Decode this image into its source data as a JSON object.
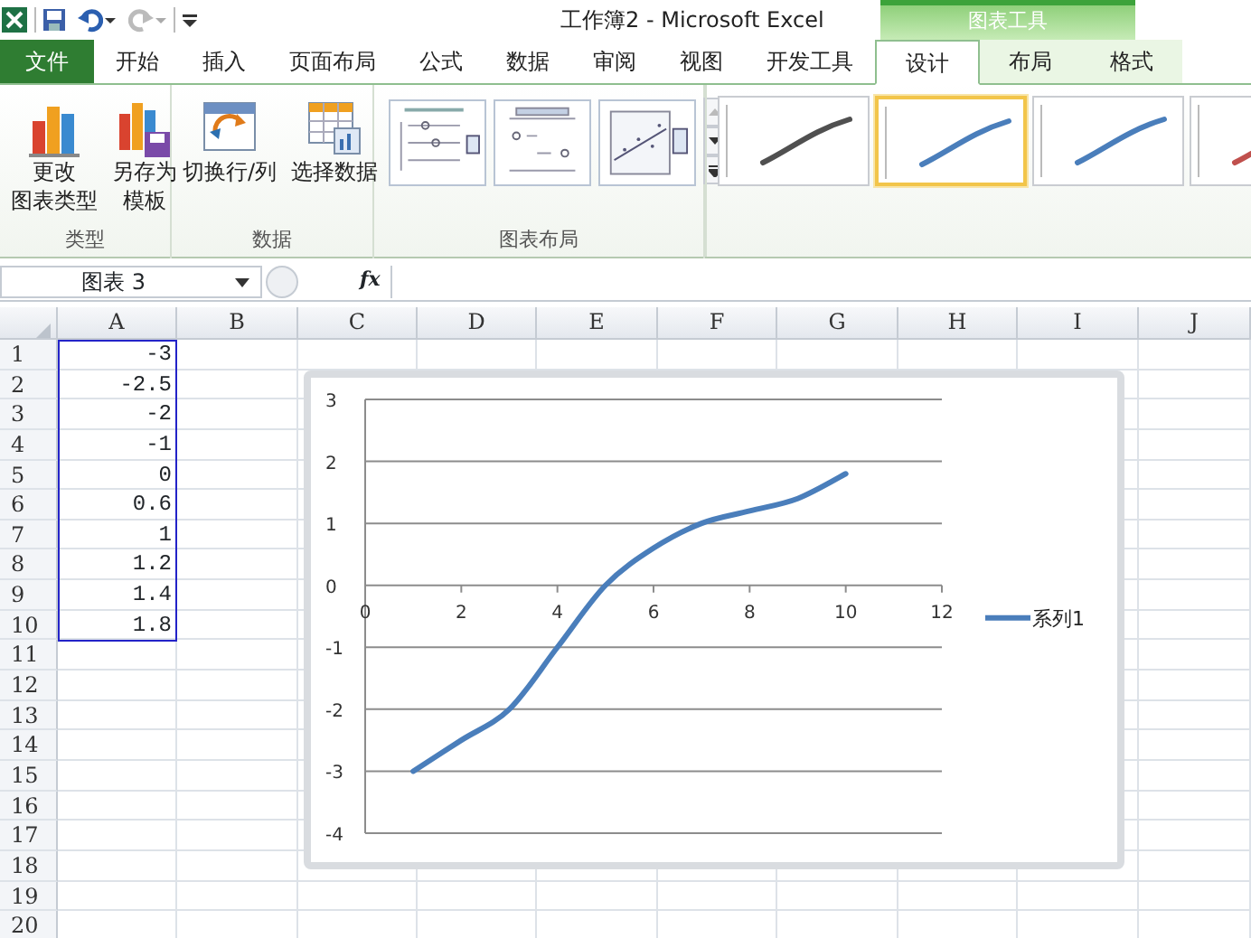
{
  "window": {
    "title": "工作簿2  -  Microsoft Excel",
    "context_header": "图表工具"
  },
  "tabs": [
    {
      "label": "文件",
      "kind": "file",
      "selected": false
    },
    {
      "label": "开始",
      "kind": "tab",
      "selected": false
    },
    {
      "label": "插入",
      "kind": "tab",
      "selected": false
    },
    {
      "label": "页面布局",
      "kind": "tab",
      "selected": false
    },
    {
      "label": "公式",
      "kind": "tab",
      "selected": false
    },
    {
      "label": "数据",
      "kind": "tab",
      "selected": false
    },
    {
      "label": "审阅",
      "kind": "tab",
      "selected": false
    },
    {
      "label": "视图",
      "kind": "tab",
      "selected": false
    },
    {
      "label": "开发工具",
      "kind": "tab",
      "selected": false
    },
    {
      "label": "设计",
      "kind": "context",
      "selected": true
    },
    {
      "label": "布局",
      "kind": "context",
      "selected": false
    },
    {
      "label": "格式",
      "kind": "context",
      "selected": false
    }
  ],
  "ribbon": {
    "groups": [
      {
        "label": "类型",
        "buttons": [
          {
            "lines": [
              "更改",
              "图表类型"
            ],
            "kind": "change-chart"
          },
          {
            "lines": [
              "另存为",
              "模板"
            ],
            "kind": "save-template"
          }
        ]
      },
      {
        "label": "数据",
        "buttons": [
          {
            "lines": [
              "切换行/列"
            ],
            "kind": "switch"
          },
          {
            "lines": [
              "选择数据"
            ],
            "kind": "select-data"
          }
        ]
      },
      {
        "label": "图表布局",
        "layouts": [
          {
            "kind": "legend-right"
          },
          {
            "kind": "legend-top"
          },
          {
            "kind": "scatter-trend"
          }
        ]
      }
    ],
    "chart_styles": [
      {
        "color": "#505050",
        "selected": false
      },
      {
        "color": "#4a7ebb",
        "selected": true
      },
      {
        "color": "#4a7ebb",
        "selected": false
      },
      {
        "color": "#c0504d",
        "selected": false
      }
    ]
  },
  "formula_bar": {
    "name_box": "图表 3",
    "fx": "fx"
  },
  "sheet": {
    "columns": [
      "A",
      "B",
      "C",
      "D",
      "E",
      "F",
      "G",
      "H",
      "I",
      "J"
    ],
    "rows": [
      {
        "number": "1",
        "a": "-3"
      },
      {
        "number": "2",
        "a": "-2.5"
      },
      {
        "number": "3",
        "a": "-2"
      },
      {
        "number": "4",
        "a": "-1"
      },
      {
        "number": "5",
        "a": "0"
      },
      {
        "number": "6",
        "a": "0.6"
      },
      {
        "number": "7",
        "a": "1"
      },
      {
        "number": "8",
        "a": "1.2"
      },
      {
        "number": "9",
        "a": "1.4"
      },
      {
        "number": "10",
        "a": "1.8"
      },
      {
        "number": "11"
      },
      {
        "number": "12"
      },
      {
        "number": "13"
      },
      {
        "number": "14"
      },
      {
        "number": "15"
      },
      {
        "number": "16"
      },
      {
        "number": "17"
      },
      {
        "number": "18"
      },
      {
        "number": "19"
      },
      {
        "number": "20"
      }
    ]
  },
  "chart": {
    "chart_data": {
      "type": "line",
      "grid": true,
      "x": [
        1,
        2,
        3,
        4,
        5,
        6,
        7,
        8,
        9,
        10
      ],
      "series": [
        {
          "name": "系列1",
          "color": "#4a7ebb",
          "values": [
            -3,
            -2.5,
            -2,
            -1,
            0,
            0.6,
            1,
            1.2,
            1.4,
            1.8
          ]
        }
      ],
      "xlim": [
        0,
        12
      ],
      "ylim": [
        -4,
        3
      ],
      "xticks": [
        0,
        2,
        4,
        6,
        8,
        10,
        12
      ],
      "yticks": [
        -4,
        -3,
        -2,
        -1,
        0,
        1,
        2,
        3
      ]
    }
  }
}
